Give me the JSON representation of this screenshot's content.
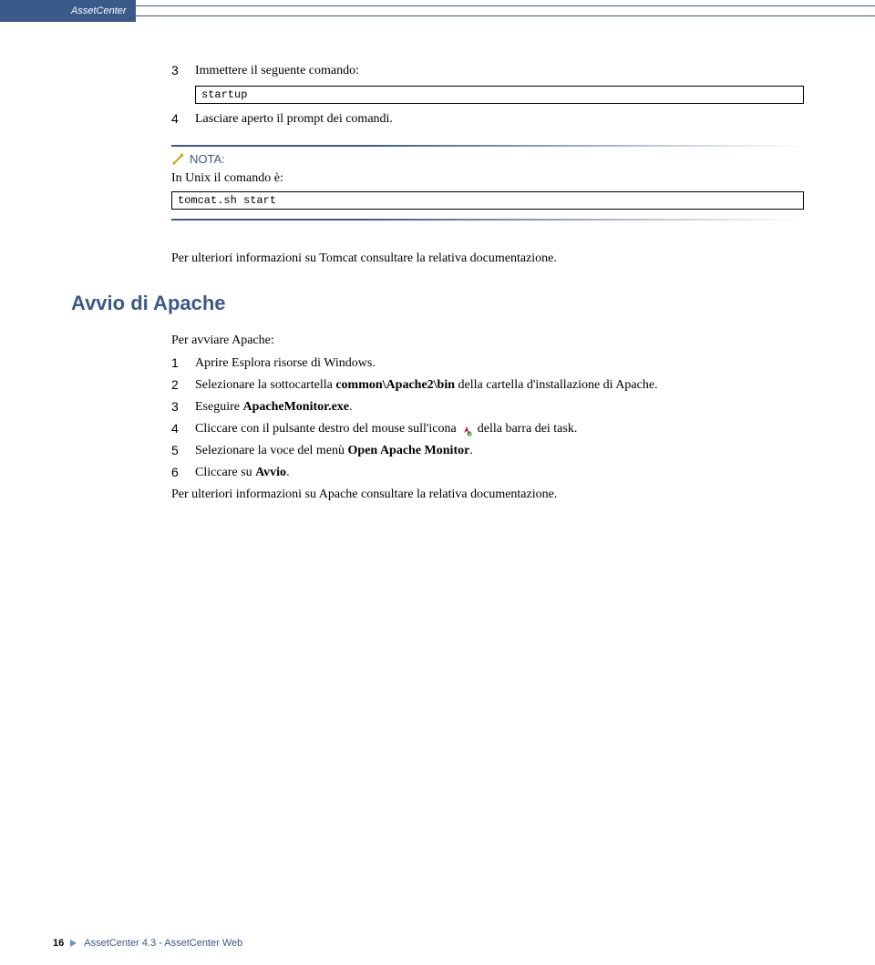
{
  "header": {
    "product": "AssetCenter"
  },
  "section1": {
    "step3_num": "3",
    "step3_text": "Immettere il seguente comando:",
    "code1": "startup",
    "step4_num": "4",
    "step4_text": "Lasciare aperto il prompt dei comandi.",
    "note_label": "NOTA:",
    "note_text": "In Unix il comando è:",
    "code2": "tomcat.sh start",
    "after_note": "Per ulteriori informazioni su Tomcat consultare la relativa documentazione."
  },
  "section2": {
    "heading": "Avvio di Apache",
    "intro": "Per avviare Apache:",
    "items": [
      {
        "num": "1",
        "text": "Aprire Esplora risorse di Windows."
      },
      {
        "num": "2",
        "pre": "Selezionare la sottocartella ",
        "bold": "common\\Apache2\\bin",
        "post": " della cartella d'installazione di Apache."
      },
      {
        "num": "3",
        "pre": "Eseguire ",
        "bold": "ApacheMonitor.exe",
        "post": "."
      },
      {
        "num": "4",
        "pre": "Cliccare con il pulsante destro del mouse sull'icona ",
        "post": " della barra dei task."
      },
      {
        "num": "5",
        "pre": "Selezionare la voce del menù ",
        "bold": "Open Apache Monitor",
        "post": "."
      },
      {
        "num": "6",
        "pre": "Cliccare su ",
        "bold": "Avvio",
        "post": "."
      }
    ],
    "outro": "Per ulteriori informazioni su Apache consultare la relativa documentazione."
  },
  "footer": {
    "page": "16",
    "text": "AssetCenter 4.3 - AssetCenter Web"
  }
}
